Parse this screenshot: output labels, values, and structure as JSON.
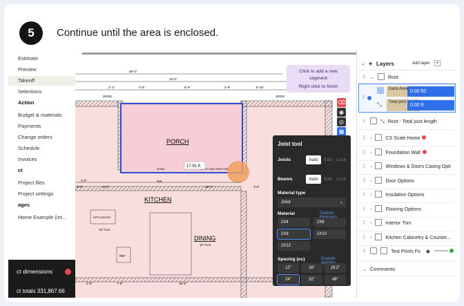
{
  "step": {
    "number": "5",
    "text": "Continue until the area is enclosed."
  },
  "sidebar": {
    "items": [
      {
        "label": "Estimate",
        "type": "item"
      },
      {
        "label": "Preview",
        "type": "item"
      },
      {
        "label": "Takeoff",
        "type": "item",
        "selected": true
      },
      {
        "label": "Selections",
        "type": "item"
      },
      {
        "label": "Action",
        "type": "section"
      },
      {
        "label": "Budget & materials",
        "type": "item"
      },
      {
        "label": "Payments",
        "type": "item"
      },
      {
        "label": "Change orders",
        "type": "item"
      },
      {
        "label": "Schedule",
        "type": "item"
      },
      {
        "label": "Invoices",
        "type": "item"
      },
      {
        "label": "ct",
        "type": "section"
      },
      {
        "label": "Project files",
        "type": "item"
      },
      {
        "label": "Project settings",
        "type": "item"
      },
      {
        "label": "ages",
        "type": "section"
      },
      {
        "label": "Home Example (int...",
        "type": "item"
      }
    ],
    "bottom_dimensions": "ct dimensions",
    "bottom_totals": "ct totals  331,867.66"
  },
  "canvas": {
    "tooltip_line1": "Click to add a new",
    "tooltip_line2": "segment",
    "tooltip_line3": "Right click to finish",
    "porch": "PORCH",
    "kitchen": "KITCHEN",
    "dining": "DINING",
    "dining_sub": "10' CLG",
    "dim_measure": "17.91 ft",
    "dim_a": "59'-0\"",
    "dim_b": "18'-0\"",
    "dim_c": "13'-4\"",
    "dim_d": "2'-1\"",
    "dim_e": "4'-9\"",
    "dim_f": "6'-6\"",
    "dim_g": "2'-8\"",
    "dim_h": "6'-10\"",
    "dim_i": "6'-4\"",
    "window_a": "26X62",
    "window_b": "30X62",
    "window_c": "30X52",
    "ceiling_note": "9/4 FR ONE SIDE FIRED",
    "appliances": "APPLIANCES",
    "ref": "REF",
    "clg": "10' CLG",
    "dw": "DW",
    "dim_k": "2'-0\"",
    "dim_l": "4'-0\"",
    "dim_m": "6'-4\"",
    "dim_n": "10'-4\"",
    "dim_o": "3'-6\"",
    "dim_p": "19'-9\"",
    "dim_q": "2'-6\"",
    "dim_r": "7'-8\""
  },
  "joist_tool": {
    "title": "Joist tool",
    "joists_label": "Joists",
    "beams_label": "Beams",
    "modes": [
      "Auto",
      "Edit",
      "Lock"
    ],
    "material_type_label": "Material type",
    "material_type_value": "Joist",
    "material_label": "Material",
    "custom_thickness": "Custom thickness",
    "materials": [
      "2X4",
      "2X6",
      "2X8",
      "2X10",
      "2X12"
    ],
    "spacing_label": "Spacing (oc)",
    "custom_spacing": "Custom spacing",
    "spacing": [
      "12\"",
      "16\"",
      "19.2\"",
      "24\"",
      "32\"",
      "48\""
    ]
  },
  "layers": {
    "title": "Layers",
    "add_layer": "Add layer",
    "root": "Root",
    "deck_area": "Deck Area",
    "deck_value": "0.00 ft2",
    "total_joist": "Total joist length",
    "joist_value": "0.00 ft",
    "root_total": "Root - Total joist length",
    "groups": [
      {
        "label": "CS Scale Home",
        "red": true
      },
      {
        "label": "Foundation Wall",
        "red": true
      },
      {
        "label": "Windows & Doors Casing Opti",
        "red": false
      },
      {
        "label": "Door Options",
        "red": false
      },
      {
        "label": "Insulation Options",
        "red": false
      },
      {
        "label": "Flooring Options",
        "red": false
      },
      {
        "label": "Interior Trim",
        "red": false
      },
      {
        "label": "Kitchen Cabinetry & Counter...",
        "red": false
      }
    ],
    "test_prints": "Test Prints Fo",
    "comments": "Comments"
  },
  "colors": {
    "accent": "#2f6fe8",
    "wall_fill": "#f9dede",
    "area_border": "#2a4fd6",
    "highlight": "#f0a060"
  }
}
